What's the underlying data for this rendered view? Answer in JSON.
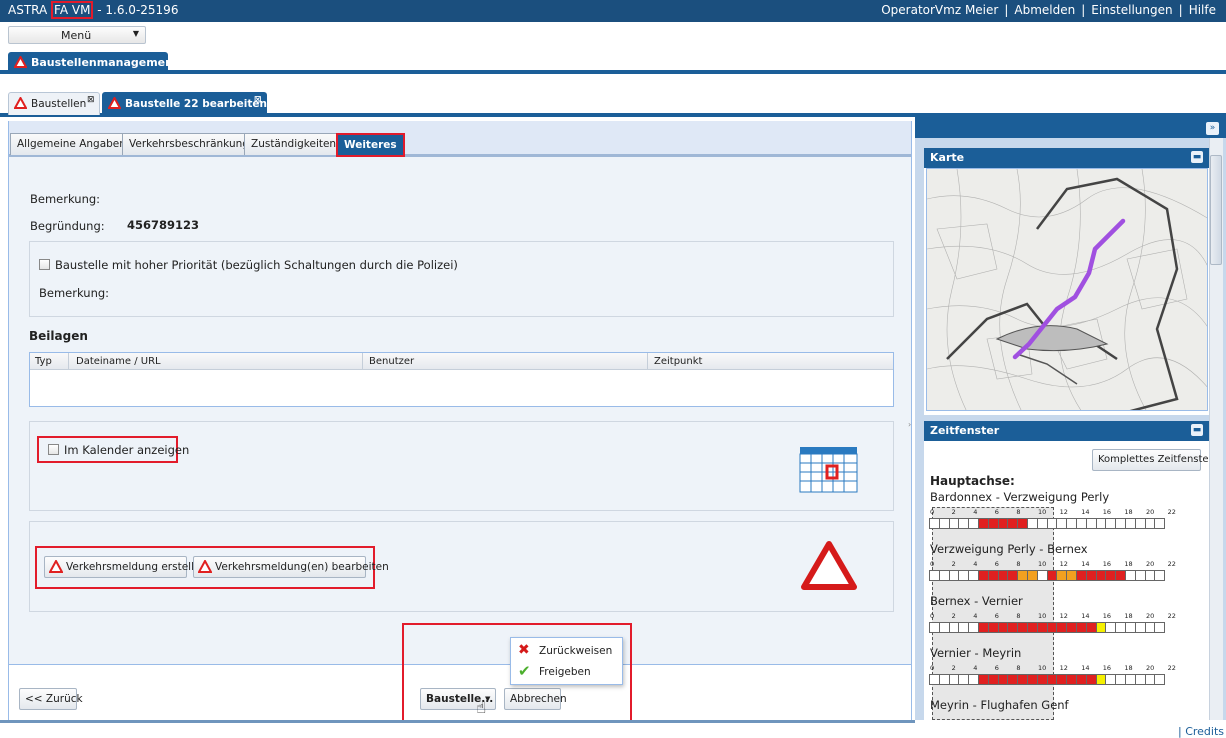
{
  "app": {
    "title_pre": "ASTRA",
    "title_hl": "FA VM",
    "title_post": "- 1.6.0-25196"
  },
  "user_links": [
    "OperatorVmz Meier",
    "Abmelden",
    "Einstellungen",
    "Hilfe"
  ],
  "menu": {
    "label": "Menü"
  },
  "module_tab": {
    "label": "Baustellenmanagement"
  },
  "doc_tabs": [
    {
      "label": "Baustellen"
    },
    {
      "label": "Baustelle 22 bearbeiten"
    }
  ],
  "inner_tabs": [
    {
      "label": "Allgemeine Angaben"
    },
    {
      "label": "Verkehrsbeschränkung"
    },
    {
      "label": "Zuständigkeiten"
    },
    {
      "label": "Weiteres"
    }
  ],
  "form": {
    "bemerkung_label": "Bemerkung:",
    "begruendung_label": "Begründung:",
    "begruendung_value": "456789123",
    "prio_checkbox": "Baustelle mit hoher Priorität (bezüglich Schaltungen durch die Polizei)",
    "prio_bemerkung_label": "Bemerkung:",
    "beilagen_title": "Beilagen",
    "grid_headers": [
      "Typ",
      "Dateiname / URL",
      "Benutzer",
      "Zeitpunkt"
    ],
    "calendar_checkbox": "Im Kalender anzeigen",
    "btn_vm_create": "Verkehrsmeldung erstellen",
    "btn_vm_edit": "Verkehrsmeldung(en) bearbeiten"
  },
  "footer": {
    "back": "<< Zurück",
    "baustelle": "Baustelle...",
    "cancel": "Abbrechen",
    "popup": [
      "Zurückweisen",
      "Freigeben"
    ]
  },
  "credits": "| Credits",
  "right": {
    "karte_title": "Karte",
    "zf_title": "Zeitfenster",
    "complete_btn": "Komplettes Zeitfenster",
    "hauptachse_label": "Hauptachse:",
    "tick_labels": [
      "0",
      "2",
      "4",
      "6",
      "8",
      "10",
      "12",
      "14",
      "16",
      "18",
      "20",
      "22"
    ],
    "segments": [
      {
        "name": "Bardonnex - Verzweigung Perly",
        "cells": [
          "w",
          "w",
          "w",
          "w",
          "w",
          "r",
          "r",
          "r",
          "r",
          "r",
          "w",
          "w",
          "w",
          "w",
          "w",
          "w",
          "w",
          "w",
          "w",
          "w",
          "w",
          "w",
          "w",
          "w"
        ]
      },
      {
        "name": "Verzweigung Perly - Bernex",
        "cells": [
          "w",
          "w",
          "w",
          "w",
          "w",
          "r",
          "r",
          "r",
          "r",
          "o",
          "o",
          "w",
          "r",
          "o",
          "o",
          "r",
          "r",
          "r",
          "r",
          "r",
          "w",
          "w",
          "w",
          "w"
        ]
      },
      {
        "name": "Bernex - Vernier",
        "cells": [
          "w",
          "w",
          "w",
          "w",
          "w",
          "r",
          "r",
          "r",
          "r",
          "r",
          "r",
          "r",
          "r",
          "r",
          "r",
          "r",
          "r",
          "y",
          "w",
          "w",
          "w",
          "w",
          "w",
          "w"
        ]
      },
      {
        "name": "Vernier - Meyrin",
        "cells": [
          "w",
          "w",
          "w",
          "w",
          "w",
          "r",
          "r",
          "r",
          "r",
          "r",
          "r",
          "r",
          "r",
          "r",
          "r",
          "r",
          "r",
          "y",
          "w",
          "w",
          "w",
          "w",
          "w",
          "w"
        ]
      },
      {
        "name": "Meyrin - Flughafen Genf",
        "cells": []
      }
    ],
    "colors": {
      "w": "#ffffff",
      "r": "#e02020",
      "o": "#f2a020",
      "y": "#f5f000"
    }
  }
}
